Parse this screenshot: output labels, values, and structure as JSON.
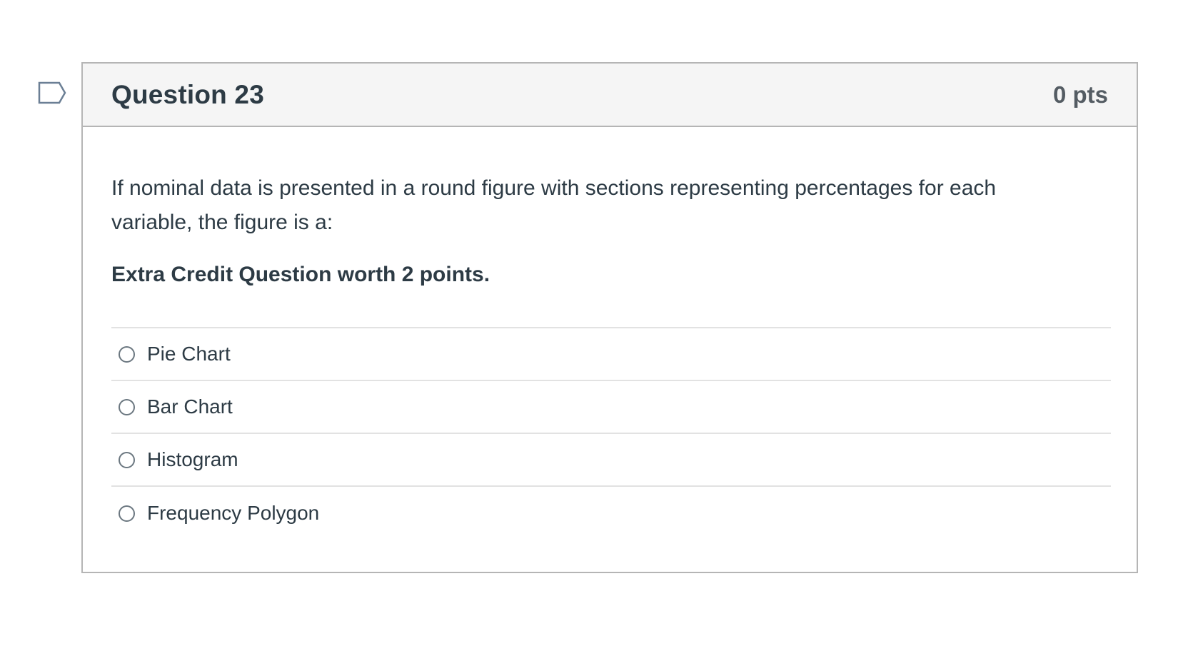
{
  "question": {
    "title": "Question 23",
    "points": "0 pts",
    "flag_icon": "flag-bookmark-icon",
    "text": "If nominal data is presented in a round figure with sections representing percentages for each variable, the figure is a:",
    "extra_credit": "Extra Credit Question worth 2 points.",
    "answers": [
      {
        "label": "Pie Chart"
      },
      {
        "label": "Bar Chart"
      },
      {
        "label": "Histogram"
      },
      {
        "label": "Frequency Polygon"
      }
    ]
  },
  "colors": {
    "text": "#2d3b45",
    "points": "#545c63",
    "header_bg": "#f5f5f5",
    "border": "#b5b5b5",
    "divider": "#e2e2e2",
    "flag": "#6b7f95"
  }
}
